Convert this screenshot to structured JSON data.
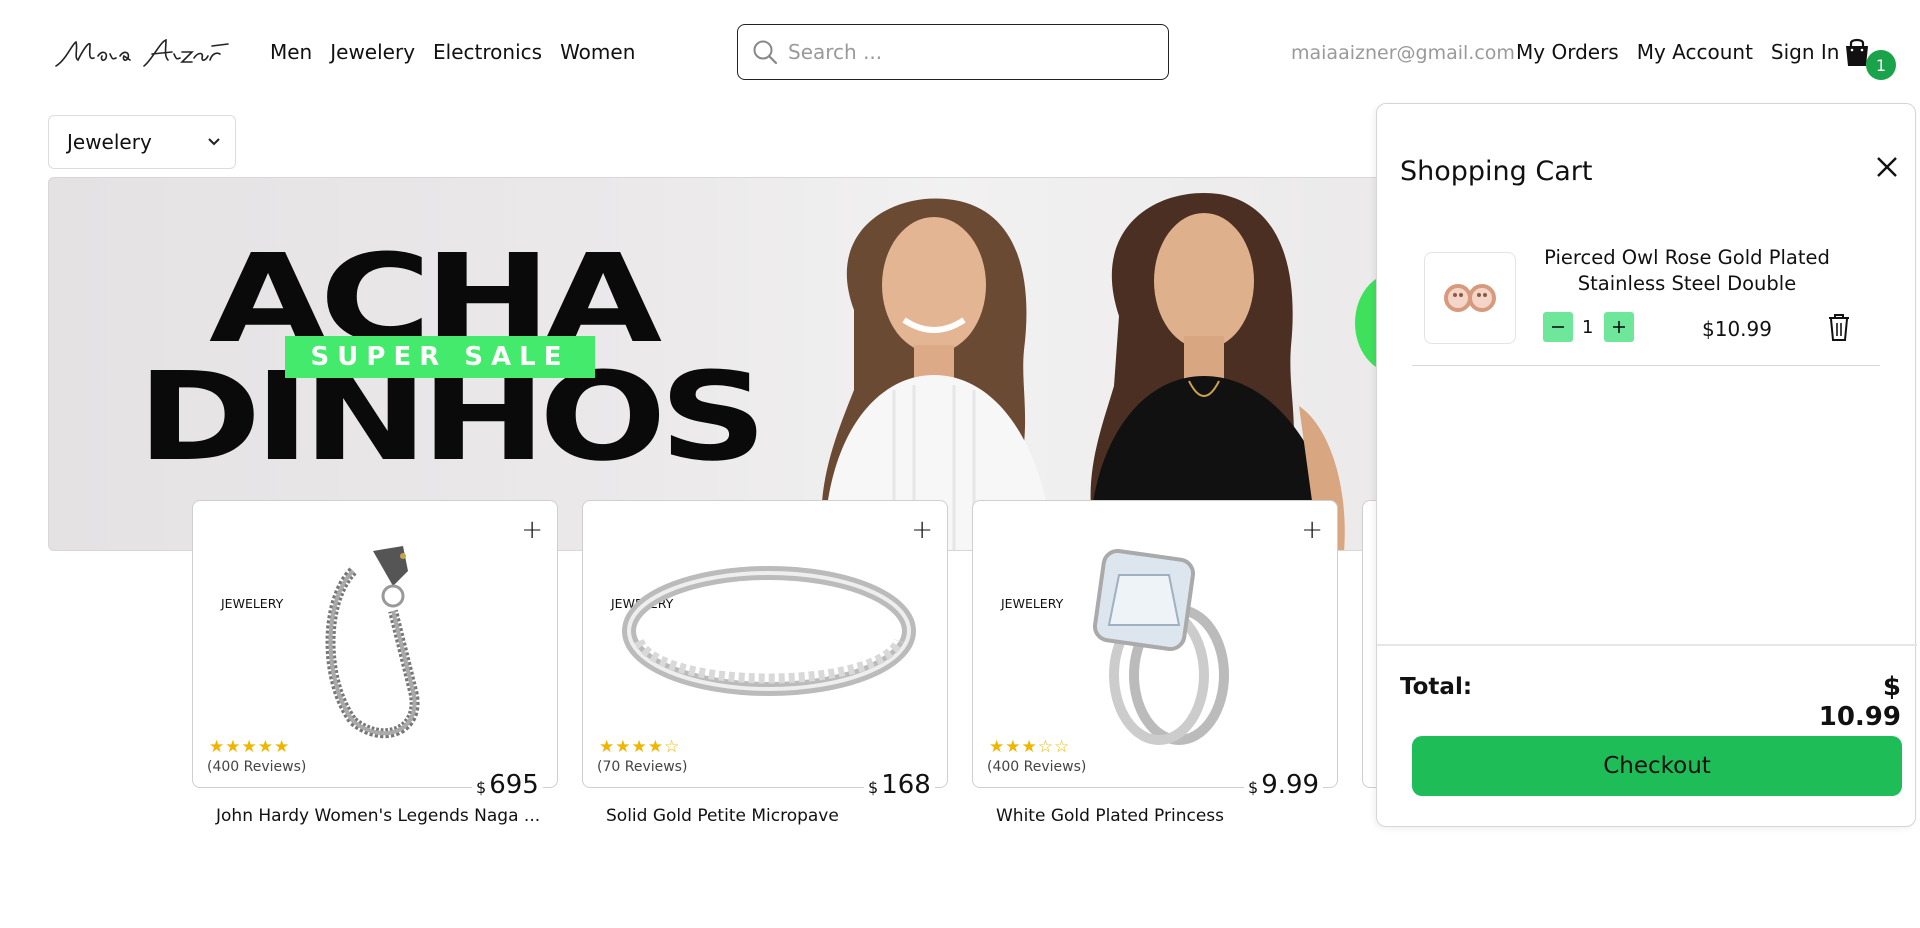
{
  "header": {
    "logo_text": "Maia Aizner",
    "nav": [
      "Men",
      "Jewelery",
      "Electronics",
      "Women"
    ],
    "search_placeholder": "Search ...",
    "email": "maiaaizner@gmail.com",
    "links": [
      "My Orders",
      "My Account",
      "Sign In"
    ],
    "cart_count": "1"
  },
  "filter": {
    "selected_category": "Jewelery"
  },
  "banner": {
    "line1": "ACHA",
    "line2": "DINHOS",
    "tag": "SUPER SALE"
  },
  "products": [
    {
      "category": "JEWELERY",
      "rating": 5,
      "stars": "★★★★★",
      "reviews": "(400 Reviews)",
      "currency": "$",
      "price": "695",
      "title": "John Hardy Women's Legends Naga ..."
    },
    {
      "category": "JEWELERY",
      "rating": 4,
      "stars": "★★★★☆",
      "reviews": "(70 Reviews)",
      "currency": "$",
      "price": "168",
      "title": "Solid Gold Petite Micropave"
    },
    {
      "category": "JEWELERY",
      "rating": 3,
      "stars": "★★★☆☆",
      "reviews": "(400 Reviews)",
      "currency": "$",
      "price": "9.99",
      "title": "White Gold Plated Princess"
    }
  ],
  "cart": {
    "title": "Shopping Cart",
    "items": [
      {
        "name_line1": "Pierced Owl Rose Gold Plated",
        "name_line2": "Stainless Steel Double",
        "quantity": "1",
        "price": "$10.99"
      }
    ],
    "total_label": "Total:",
    "total_value": "$ 10.99",
    "checkout_label": "Checkout"
  },
  "colors": {
    "accent_green": "#1fbd57",
    "qty_green": "#6ee79a",
    "badge_green": "#1aa34a",
    "sale_green": "#43ea6b",
    "star_gold": "#f1b500"
  }
}
